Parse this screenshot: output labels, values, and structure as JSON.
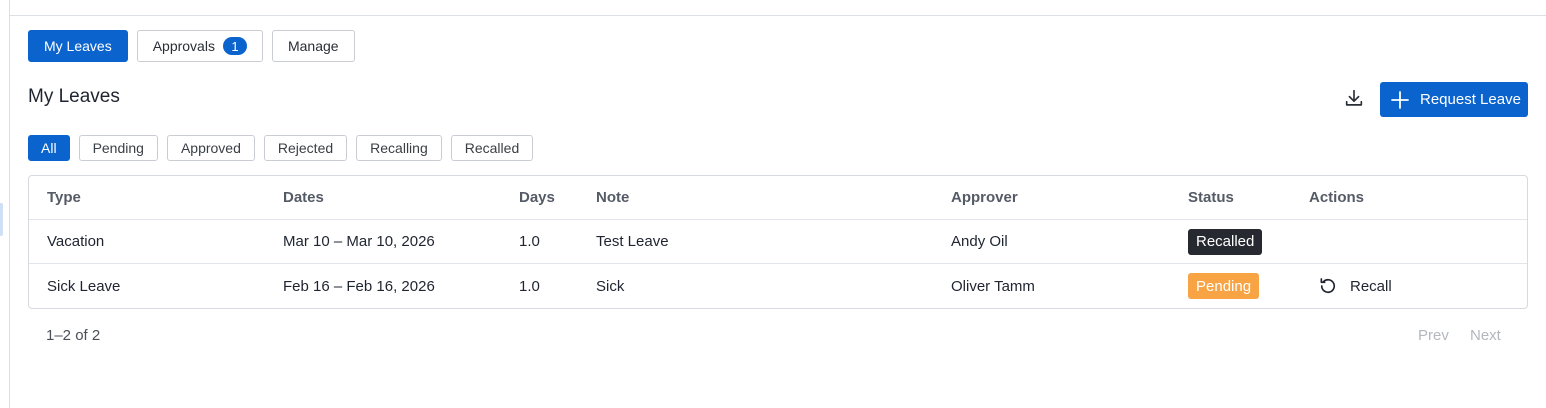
{
  "tabs": [
    {
      "label": "My Leaves",
      "active": true
    },
    {
      "label": "Approvals",
      "badge": "1",
      "active": false
    },
    {
      "label": "Manage",
      "active": false
    }
  ],
  "header": {
    "title": "My Leaves",
    "download_icon": "download-icon",
    "request_label": "Request Leave"
  },
  "filters": [
    {
      "label": "All",
      "active": true
    },
    {
      "label": "Pending",
      "active": false
    },
    {
      "label": "Approved",
      "active": false
    },
    {
      "label": "Rejected",
      "active": false
    },
    {
      "label": "Recalling",
      "active": false
    },
    {
      "label": "Recalled",
      "active": false
    }
  ],
  "table": {
    "columns": [
      "Type",
      "Dates",
      "Days",
      "Note",
      "Approver",
      "Status",
      "Actions"
    ],
    "rows": [
      {
        "type": "Vacation",
        "dates": "Mar 10 – Mar 10, 2026",
        "days": "1.0",
        "note": "Test Leave",
        "approver": "Andy Oil",
        "status": "Recalled",
        "status_color": "#262a30",
        "action": ""
      },
      {
        "type": "Sick Leave",
        "dates": "Feb 16 – Feb 16, 2026",
        "days": "1.0",
        "note": "Sick",
        "approver": "Oliver Tamm",
        "status": "Pending",
        "status_color": "#f8a444",
        "action": "Recall"
      }
    ]
  },
  "pagination": {
    "range": "1–2 of 2",
    "prev": "Prev",
    "next": "Next"
  },
  "colors": {
    "accent": "#0b63ce",
    "recalled": "#262a30",
    "pending": "#f8a444"
  }
}
